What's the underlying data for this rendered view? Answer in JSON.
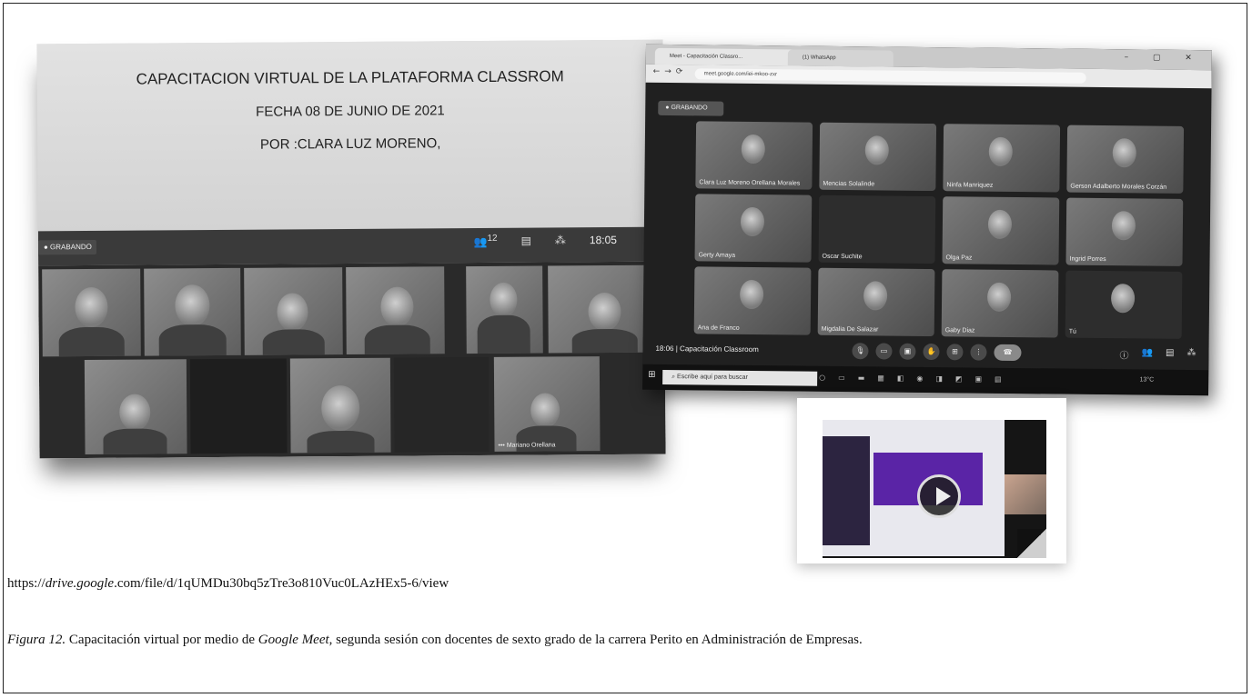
{
  "photo1": {
    "title_lines": [
      "CAPACITACION VIRTUAL DE LA PLATAFORMA CLASSROM",
      "FECHA 08 DE JUNIO DE 2021",
      "POR :CLARA LUZ MORENO,"
    ],
    "recording_label": "GRABANDO",
    "participant_count": "12",
    "time": "18:05",
    "participant_name": "Mariano Orellana"
  },
  "photo2": {
    "tab1": "Meet - Capacitación Classro...",
    "tab2": "(1) WhatsApp",
    "url": "meet.google.com/iei-mkoo-zxr",
    "recording_label": "GRABANDO",
    "participants": [
      "Clara Luz Moreno Orellana Morales",
      "Mencias Solalinde",
      "Ninfa Manriquez",
      "Gerson Adalberto Morales Corzán",
      "Gerty Amaya",
      "Oscar Suchite",
      "Olga Paz",
      "Ingrid Porres",
      "Ana de Franco",
      "Migdalia De Salazar",
      "Gaby Diaz",
      "Tú"
    ],
    "meeting_time": "18:06",
    "meeting_name": "Capacitación Classroom",
    "search_placeholder": "Escribe aquí para buscar",
    "weather": "13°C"
  },
  "link_prefix": "https://",
  "link_domain": "drive.google",
  "link_suffix": ".com/file/d/1qUMDu30bq5zTre3o810Vuc0LAzHEx5-6/view",
  "caption": {
    "figure_label": "Figura 12.",
    "text_before": " Capacitación virtual por medio de ",
    "product": "Google Meet",
    "text_after": ", segunda sesión con docentes de sexto grado de la carrera Perito en Administración de Empresas."
  }
}
